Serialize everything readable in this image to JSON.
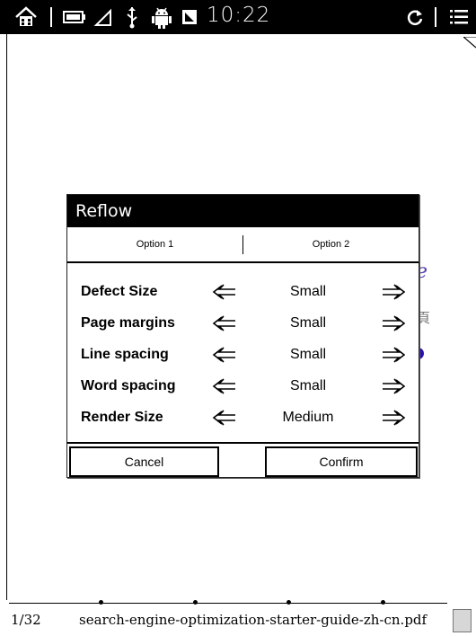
{
  "status_bar": {
    "time": "10:22",
    "icons": [
      "home-icon",
      "battery-icon",
      "signal-icon",
      "usb-icon",
      "android-icon",
      "notification-icon",
      "sync-icon",
      "menu-icon"
    ]
  },
  "background_glyphs": [
    "e",
    "頁"
  ],
  "dialog": {
    "title": "Reflow",
    "tabs": [
      "Option 1",
      "Option 2"
    ],
    "rows": [
      {
        "label": "Defect Size",
        "value": "Small"
      },
      {
        "label": "Page margins",
        "value": "Small"
      },
      {
        "label": "Line spacing",
        "value": "Small"
      },
      {
        "label": "Word spacing",
        "value": "Small"
      },
      {
        "label": "Render Size",
        "value": "Medium"
      }
    ],
    "cancel_label": "Cancel",
    "confirm_label": "Confirm"
  },
  "footer": {
    "page_indicator": "1/32",
    "file_name": "search-engine-optimization-starter-guide-zh-cn.pdf"
  }
}
